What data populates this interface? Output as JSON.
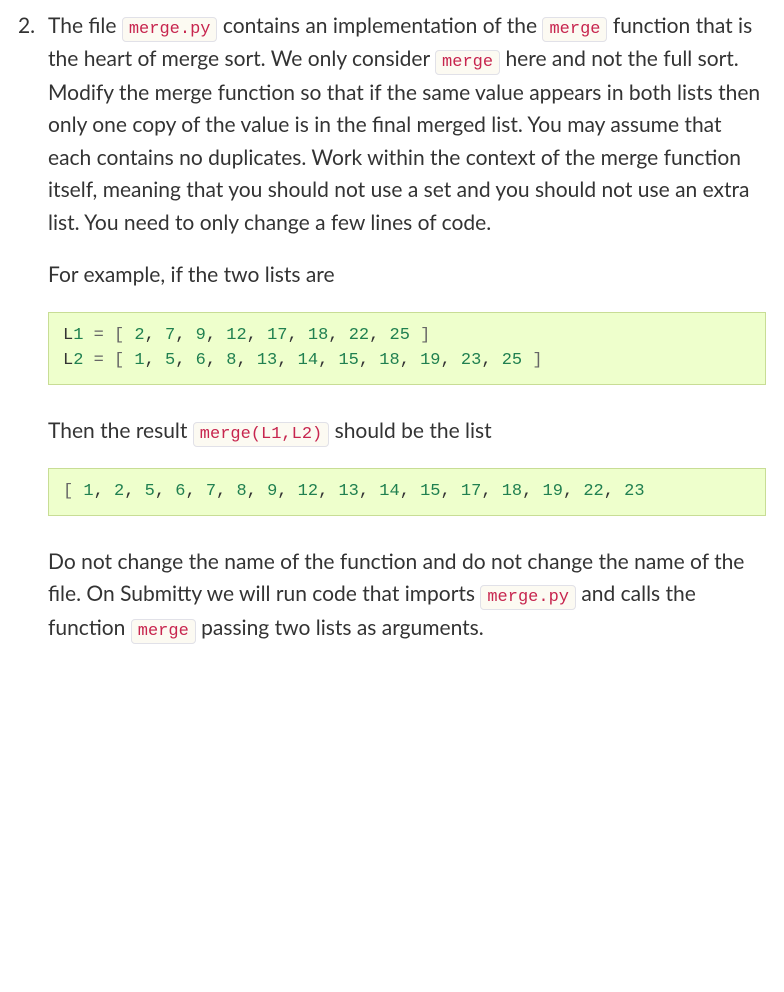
{
  "problem": {
    "number": "2.",
    "para1_parts": [
      {
        "t": "text",
        "v": "The file "
      },
      {
        "t": "code",
        "v": "merge.py"
      },
      {
        "t": "text",
        "v": " contains an implementation of the "
      },
      {
        "t": "code",
        "v": "merge"
      },
      {
        "t": "text",
        "v": " function that is the heart of merge sort. We only consider "
      },
      {
        "t": "code",
        "v": "merge"
      },
      {
        "t": "text",
        "v": " here and not the full sort. Modify the merge function so that if the same value appears in both lists then only one copy of the value is in the final merged list. You may assume that each contains no duplicates. Work within the context of the merge function itself, meaning that you should not use a set and you should not use an extra list. You need to only change a few lines of code."
      }
    ],
    "para2": "For example, if the two lists are",
    "codeblock1": "L1 = [ 2, 7, 9, 12, 17, 18, 22, 25 ]\nL2 = [ 1, 5, 6, 8, 13, 14, 15, 18, 19, 23, 25 ]",
    "para3_parts": [
      {
        "t": "text",
        "v": "Then the result "
      },
      {
        "t": "code",
        "v": "merge(L1,L2)"
      },
      {
        "t": "text",
        "v": " should be the list"
      }
    ],
    "codeblock2": "[ 1, 2, 5, 6, 7, 8, 9, 12, 13, 14, 15, 17, 18, 19, 22, 23",
    "para4_parts": [
      {
        "t": "text",
        "v": "Do not change the name of the function and do not change the name of the file. On Submitty we will run code that imports "
      },
      {
        "t": "code",
        "v": "merge.py"
      },
      {
        "t": "text",
        "v": " and calls the function "
      },
      {
        "t": "code",
        "v": "merge"
      },
      {
        "t": "text",
        "v": " passing two lists as arguments."
      }
    ]
  }
}
